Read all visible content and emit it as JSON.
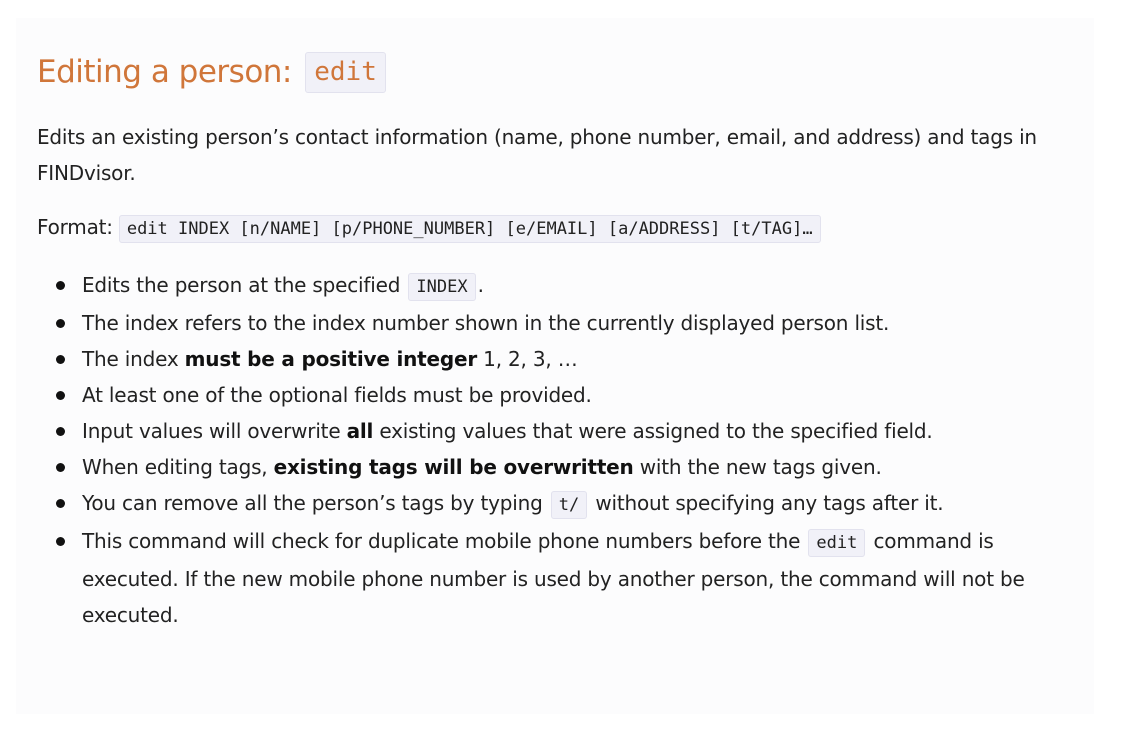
{
  "section": {
    "title": "Editing a person:",
    "title_code": "edit",
    "description": "Edits an existing person’s contact information (name, phone number, email, and address) and tags in FINDvisor.",
    "format_label": "Format:",
    "format_code": "edit INDEX [n/NAME] [p/PHONE_NUMBER] [e/EMAIL] [a/ADDRESS] [t/TAG]…"
  },
  "bullets": {
    "b1": {
      "pre": "Edits the person at the specified ",
      "code": "INDEX",
      "post": "."
    },
    "b2": {
      "text": "The index refers to the index number shown in the currently displayed person list."
    },
    "b3": {
      "pre": "The index ",
      "bold": "must be a positive integer",
      "post": " 1, 2, 3, …"
    },
    "b4": {
      "text": "At least one of the optional fields must be provided."
    },
    "b5": {
      "pre": "Input values will overwrite ",
      "bold": "all",
      "post": " existing values that were assigned to the specified field."
    },
    "b6": {
      "pre": "When editing tags, ",
      "bold": "existing tags will be overwritten",
      "post": " with the new tags given."
    },
    "b7": {
      "pre": "You can remove all the person’s tags by typing ",
      "code": "t/",
      "post": " without specifying any tags after it."
    },
    "b8": {
      "pre": "This command will check for duplicate mobile phone numbers before the ",
      "code": "edit",
      "post": " command is executed. If the new mobile phone number is used by another person, the command will not be executed."
    }
  }
}
